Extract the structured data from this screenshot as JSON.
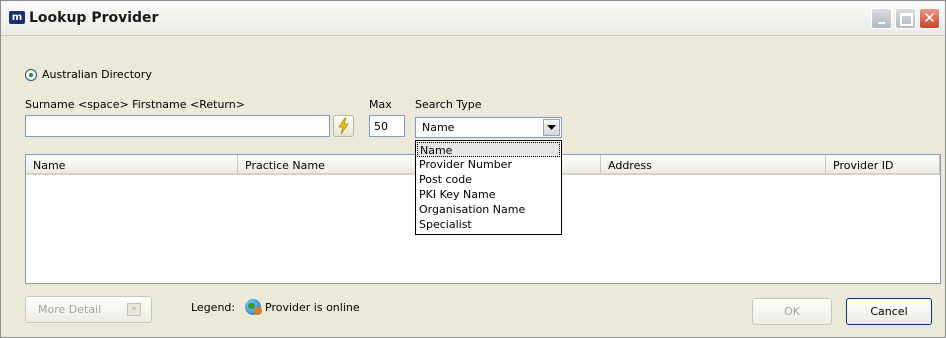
{
  "window": {
    "title": "Lookup Provider"
  },
  "titlebar": {
    "minimize_icon": "minimize-icon",
    "maximize_icon": "maximize-icon",
    "close_icon": "close-icon"
  },
  "directory": {
    "label": "Australian Directory",
    "selected": true
  },
  "search": {
    "name_label": "Surname <space> Firstname <Return>",
    "name_value": "",
    "max_label": "Max",
    "max_value": "50",
    "type_label": "Search Type",
    "type_value": "Name",
    "options": [
      "Name",
      "Provider Number",
      "Post code",
      "PKI Key Name",
      "Organisation Name",
      "Specialist"
    ]
  },
  "table": {
    "columns": [
      "Name",
      "Practice Name",
      "Address",
      "Provider ID"
    ],
    "rows": []
  },
  "footer": {
    "more_detail": "More Detail",
    "legend_label": "Legend:",
    "legend_text": "Provider is online",
    "ok": "OK",
    "cancel": "Cancel"
  },
  "colors": {
    "accent": "#0a246a",
    "close": "#c9442a",
    "lightning": "#f2c200"
  }
}
